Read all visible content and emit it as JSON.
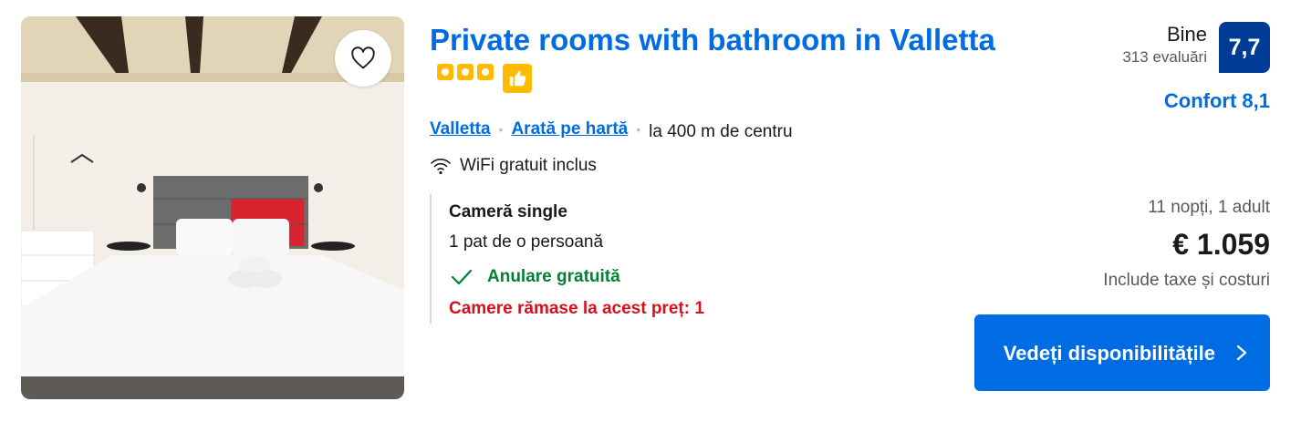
{
  "property": {
    "title": "Private rooms with bathroom in Valletta",
    "stars": 3,
    "image_alt": "hotel-room-photo"
  },
  "location": {
    "city_link": "Valletta",
    "map_link": "Arată pe hartă",
    "distance": "la 400 m de centru"
  },
  "amenity": {
    "wifi_text": "WiFi gratuit inclus",
    "icon": "wifi-icon"
  },
  "room": {
    "name": "Cameră single",
    "bed": "1 pat de o persoană",
    "cancellation": "Anulare gratuită",
    "availability": "Camere rămase la acest preț: 1"
  },
  "review": {
    "word": "Bine",
    "count": "313 evaluări",
    "score": "7,7",
    "comfort": "Confort 8,1"
  },
  "pricing": {
    "stay": "11 nopți, 1 adult",
    "price": "€ 1.059",
    "taxes": "Include taxe și costuri"
  },
  "cta": {
    "label": "Vedeți disponibilitățile"
  },
  "colors": {
    "link": "#006ce4",
    "score_bg": "#003b95",
    "green": "#008234",
    "red": "#d4111e",
    "star": "#febb02"
  }
}
